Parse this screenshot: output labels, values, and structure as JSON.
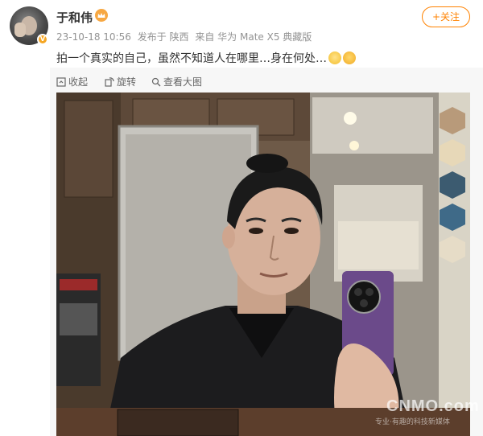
{
  "user": {
    "name": "于和伟",
    "badge_icon": "crown-icon",
    "verified_badge": "V"
  },
  "meta": {
    "time": "23-10-18 10:56",
    "location": "发布于 陕西",
    "source": "来自 华为 Mate X5 典藏版"
  },
  "follow_button": "+关注",
  "post": {
    "text": "拍一个真实的自己，虽然不知道人在哪里…身在何处…",
    "emojis": [
      "shy-face-emoji",
      "shocked-face-emoji"
    ]
  },
  "toolbar": {
    "collapse": "收起",
    "rotate": "旋转",
    "view_large": "查看大图"
  },
  "photo": {
    "watermark": "CNMO.com",
    "watermark_sub": "专业·有趣的科技新媒体"
  },
  "colors": {
    "accent": "#ff8200",
    "meta_text": "#939393",
    "toolbar_bg": "#f7f7f7",
    "phone_purple": "#6b4a8a"
  }
}
